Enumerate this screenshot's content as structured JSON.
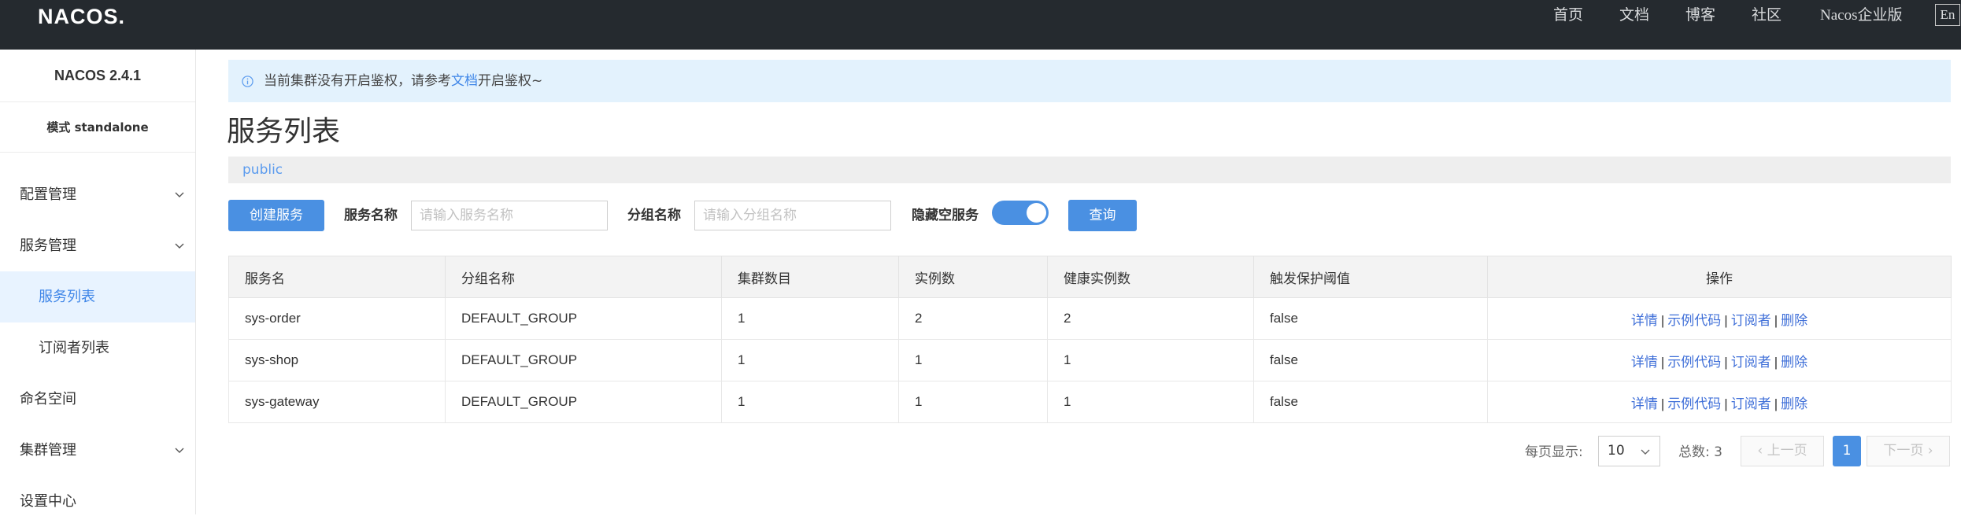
{
  "header": {
    "logo": "NACOS.",
    "nav": [
      "首页",
      "文档",
      "博客",
      "社区",
      "Nacos企业版"
    ],
    "lang": "En"
  },
  "sidebar": {
    "title": "NACOS 2.4.1",
    "mode": "模式 standalone",
    "items": [
      {
        "label": "配置管理"
      },
      {
        "label": "服务管理"
      },
      {
        "label": "服务列表"
      },
      {
        "label": "订阅者列表"
      },
      {
        "label": "命名空间"
      },
      {
        "label": "集群管理"
      },
      {
        "label": "设置中心"
      }
    ]
  },
  "notice": {
    "before": "当前集群没有开启鉴权，请参考",
    "link": "文档",
    "after": "开启鉴权~"
  },
  "page": {
    "title": "服务列表",
    "namespace": "public"
  },
  "filters": {
    "create_label": "创建服务",
    "service_name_label": "服务名称",
    "service_name_placeholder": "请输入服务名称",
    "group_name_label": "分组名称",
    "group_name_placeholder": "请输入分组名称",
    "hide_empty_label": "隐藏空服务",
    "hide_empty_on": true,
    "query_label": "查询"
  },
  "table": {
    "headers": [
      "服务名",
      "分组名称",
      "集群数目",
      "实例数",
      "健康实例数",
      "触发保护阈值",
      "操作"
    ],
    "actions": [
      "详情",
      "示例代码",
      "订阅者",
      "删除"
    ],
    "rows": [
      [
        "sys-order",
        "DEFAULT_GROUP",
        "1",
        "2",
        "2",
        "false"
      ],
      [
        "sys-shop",
        "DEFAULT_GROUP",
        "1",
        "1",
        "1",
        "false"
      ],
      [
        "sys-gateway",
        "DEFAULT_GROUP",
        "1",
        "1",
        "1",
        "false"
      ]
    ]
  },
  "pagination": {
    "page_size_label": "每页显示:",
    "page_size": "10",
    "total_label": "总数:",
    "total": "3",
    "prev": "上一页",
    "current": "1",
    "next": "下一页"
  }
}
